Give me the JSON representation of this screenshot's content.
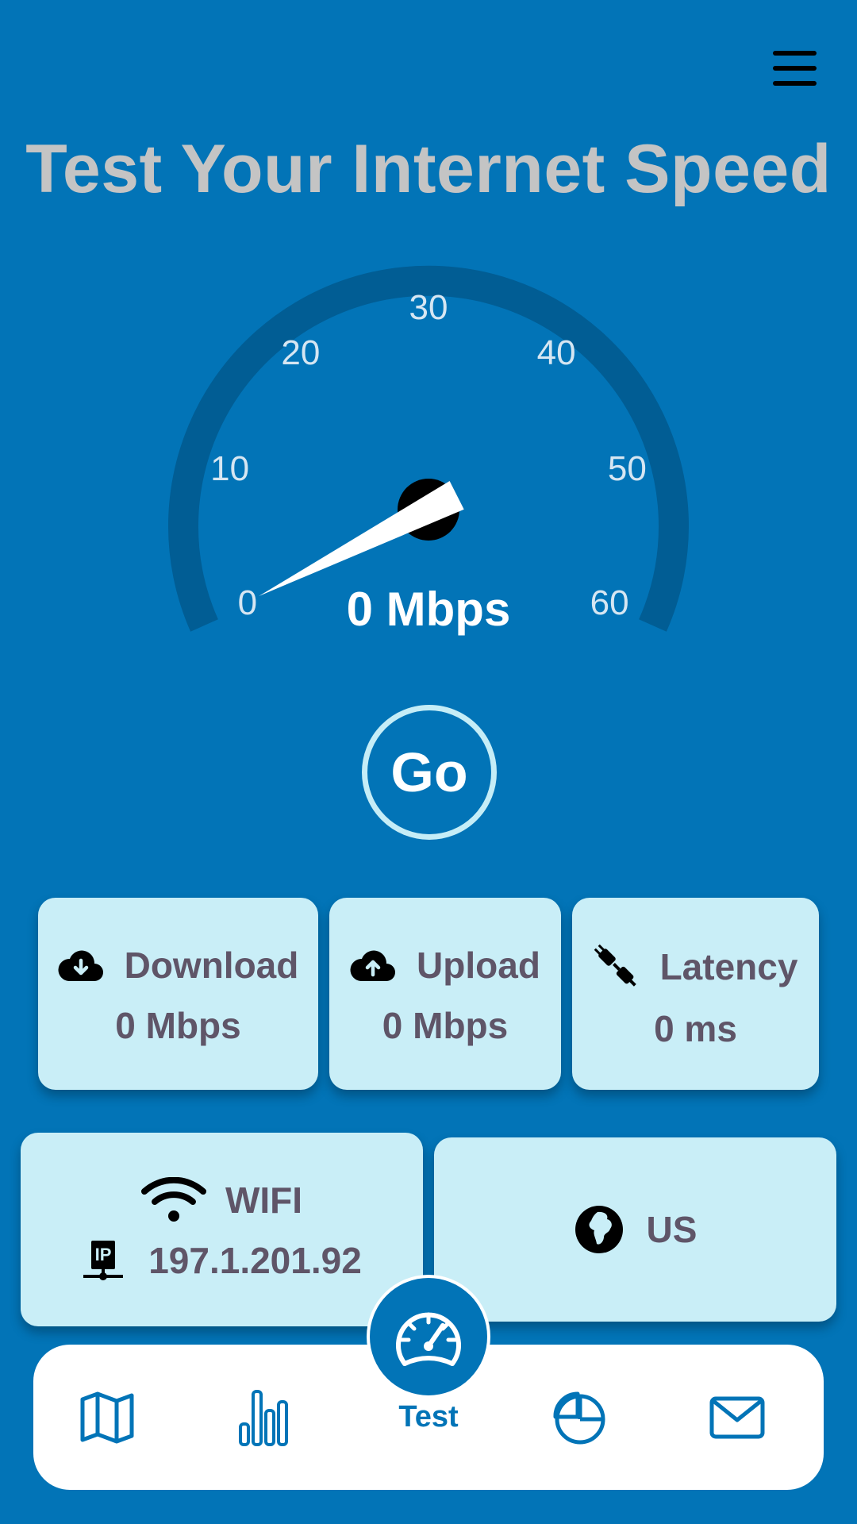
{
  "header": {
    "title": "Test Your Internet Speed",
    "menu_icon": "hamburger-menu-icon"
  },
  "gauge": {
    "ticks": [
      "0",
      "10",
      "20",
      "30",
      "40",
      "50",
      "60"
    ],
    "min": 0,
    "max": 60,
    "current_value": 0,
    "readout": "0 Mbps",
    "colors": {
      "track": "#015d94",
      "needle": "#ffffff",
      "hub": "#000000",
      "tick_text": "#d6e6f2"
    }
  },
  "go_button": {
    "label": "Go"
  },
  "stats": {
    "download": {
      "label": "Download",
      "value": "0 Mbps",
      "icon": "cloud-download-icon"
    },
    "upload": {
      "label": "Upload",
      "value": "0 Mbps",
      "icon": "cloud-upload-icon"
    },
    "latency": {
      "label": "Latency",
      "value": "0 ms",
      "icon": "plug-icon"
    }
  },
  "network": {
    "type": "WIFI",
    "type_icon": "wifi-icon",
    "ip": "197.1.201.92",
    "ip_icon": "ip-address-icon",
    "country": "US",
    "country_icon": "globe-icon"
  },
  "bottom_nav": {
    "items": [
      {
        "name": "map",
        "icon": "map-icon"
      },
      {
        "name": "stats",
        "icon": "bar-chart-icon"
      },
      {
        "name": "test",
        "icon": "speedometer-icon",
        "label": "Test"
      },
      {
        "name": "history",
        "icon": "pie-chart-icon"
      },
      {
        "name": "contact",
        "icon": "mail-icon"
      }
    ],
    "active": "test"
  },
  "colors": {
    "background": "#0274b7",
    "card": "#c9eef7",
    "card_text": "#5f5568",
    "title": "#c4c4c4"
  }
}
